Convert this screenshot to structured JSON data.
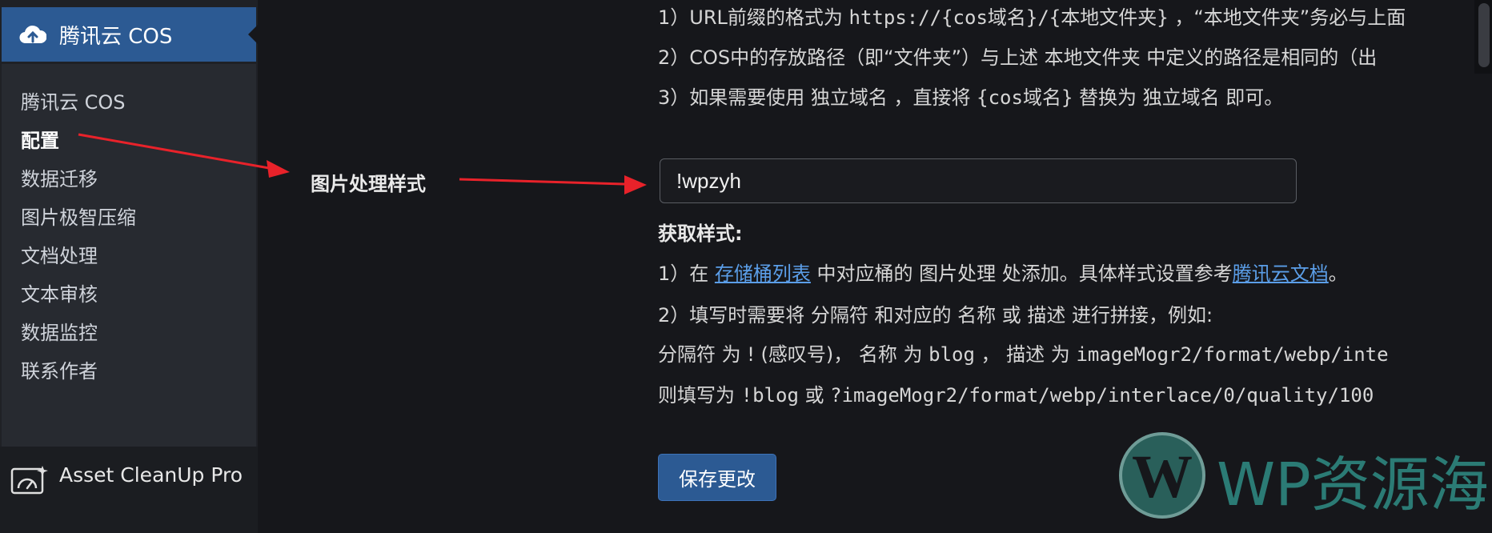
{
  "sidebar": {
    "header_label": "腾讯云 COS",
    "items": [
      {
        "label": "腾讯云 COS",
        "current": false
      },
      {
        "label": "配置",
        "current": true
      },
      {
        "label": "数据迁移",
        "current": false
      },
      {
        "label": "图片极智压缩",
        "current": false
      },
      {
        "label": "文档处理",
        "current": false
      },
      {
        "label": "文本审核",
        "current": false
      },
      {
        "label": "数据监控",
        "current": false
      },
      {
        "label": "联系作者",
        "current": false
      }
    ],
    "asset_cleanup_label": "Asset CleanUp Pro"
  },
  "url_notes": {
    "line1_a": "1）URL前缀的格式为 ",
    "line1_code": "https://{cos域名}/{本地文件夹}",
    "line1_b": " ，“本地文件夹”务必与上面",
    "line2": "2）COS中的存放路径（即“文件夹”）与上述 本地文件夹 中定义的路径是相同的（出",
    "line3_a": "3）如果需要使用 独立域名 ，直接将 ",
    "line3_code": "{cos域名}",
    "line3_b": " 替换为 独立域名 即可。"
  },
  "callout_label": "图片处理样式",
  "style_input": {
    "value": "!wpzyh"
  },
  "get_style": {
    "title": "获取样式:",
    "line1_a": "1）在 ",
    "line1_link": "存储桶列表",
    "line1_b": " 中对应桶的 图片处理 处添加。具体样式设置参考",
    "line1_link2": "腾讯云文档",
    "line1_c": "。",
    "line2": "2）填写时需要将 分隔符 和对应的 名称 或 描述 进行拼接，例如:",
    "line3_a": " 分隔符 为 ! (感叹号)， 名称 为 ",
    "line3_code1": "blog",
    "line3_b": " ， 描述 为 ",
    "line3_code2": "imageMogr2/format/webp/inte",
    "line4_a": "则填写为 ",
    "line4_code1": "!blog",
    "line4_b": " 或 ",
    "line4_code2": "?imageMogr2/format/webp/interlace/0/quality/100"
  },
  "save_button_label": "保存更改",
  "watermark": {
    "logo_letter": "W",
    "text": "WP资源海"
  },
  "colors": {
    "accent": "#2c5a93",
    "link": "#5b9ee8",
    "arrow": "#e8222a",
    "background": "#16171b"
  }
}
